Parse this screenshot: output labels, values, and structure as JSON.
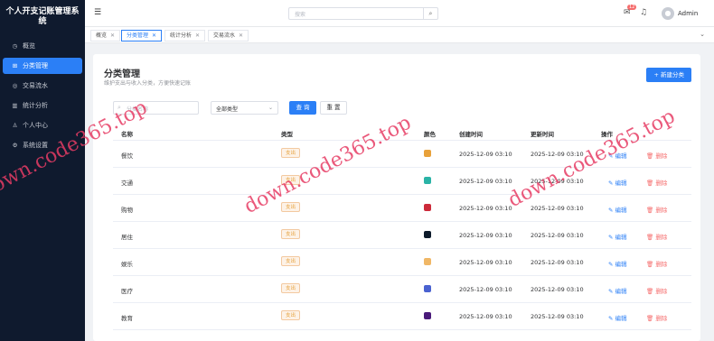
{
  "sidebar": {
    "brand": "个人开支记账管理系统",
    "items": [
      {
        "label": "概览",
        "icon": "dashboard-icon",
        "glyph": "◷",
        "active": false
      },
      {
        "label": "分类管理",
        "icon": "category-icon",
        "glyph": "⊞",
        "active": true
      },
      {
        "label": "交易流水",
        "icon": "transaction-icon",
        "glyph": "◎",
        "active": false
      },
      {
        "label": "统计分析",
        "icon": "chart-icon",
        "glyph": "▥",
        "active": false
      },
      {
        "label": "个人中心",
        "icon": "user-icon",
        "glyph": "♙",
        "active": false
      },
      {
        "label": "系统设置",
        "icon": "gear-icon",
        "glyph": "⚙",
        "active": false
      }
    ]
  },
  "header": {
    "search_placeholder": "搜索",
    "notification_count": "12",
    "username": "Admin"
  },
  "tabs": [
    {
      "label": "概览",
      "active": false
    },
    {
      "label": "分类管理",
      "active": true
    },
    {
      "label": "统计分析",
      "active": false
    },
    {
      "label": "交易流水",
      "active": false
    }
  ],
  "page": {
    "title": "分类管理",
    "subtitle": "维护支出与收入分类，方便快速记账",
    "new_button": "+ 新建分类"
  },
  "filters": {
    "name_placeholder": "分类名称",
    "type_value": "全部类型",
    "query_label": "查 询",
    "reset_label": "重 置"
  },
  "table": {
    "headers": {
      "name": "名称",
      "type": "类型",
      "color": "颜色",
      "created": "创建时间",
      "updated": "更新时间",
      "actions": "操作"
    },
    "edit_label": "编辑",
    "delete_label": "删除",
    "rows": [
      {
        "name": "餐饮",
        "type": "支出",
        "color": "#e8a13a",
        "created": "2025-12-09 03:10",
        "updated": "2025-12-09 03:10"
      },
      {
        "name": "交通",
        "type": "支出",
        "color": "#2ab3a6",
        "created": "2025-12-09 03:10",
        "updated": "2025-12-09 03:10"
      },
      {
        "name": "购物",
        "type": "支出",
        "color": "#cc2a3a",
        "created": "2025-12-09 03:10",
        "updated": "2025-12-09 03:10"
      },
      {
        "name": "居住",
        "type": "支出",
        "color": "#0c1a2a",
        "created": "2025-12-09 03:10",
        "updated": "2025-12-09 03:10"
      },
      {
        "name": "娱乐",
        "type": "支出",
        "color": "#f0b766",
        "created": "2025-12-09 03:10",
        "updated": "2025-12-09 03:10"
      },
      {
        "name": "医疗",
        "type": "支出",
        "color": "#4a62d0",
        "created": "2025-12-09 03:10",
        "updated": "2025-12-09 03:10"
      },
      {
        "name": "教育",
        "type": "支出",
        "color": "#4a1a7a",
        "created": "2025-12-09 03:10",
        "updated": "2025-12-09 03:10"
      }
    ]
  },
  "watermark": "down.code365.top"
}
